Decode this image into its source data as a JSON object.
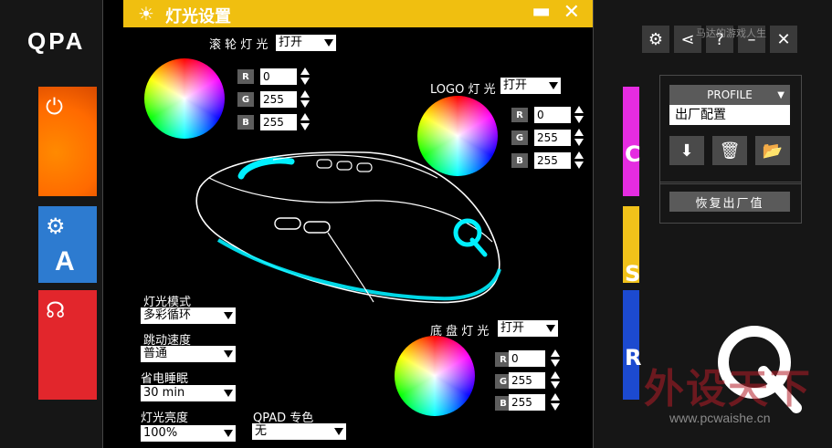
{
  "background_app": {
    "brand": "QPA",
    "watermark_top": "马达的游戏人生",
    "profile": {
      "header": "PROFILE",
      "name": "出厂配置"
    },
    "restore_label": "恢复出厂值",
    "stripes": [
      "C",
      "S",
      "R"
    ],
    "tile_letters": [
      "A"
    ],
    "site_mark": "外设天下",
    "site_url": "www.pcwaishe.cn"
  },
  "dialog": {
    "title": "灯光设置",
    "scroll": {
      "label": "滚 轮 灯 光",
      "mode": "打开",
      "rgb": {
        "R": "0",
        "G": "255",
        "B": "255"
      }
    },
    "logo": {
      "label": "LOGO 灯 光",
      "mode": "打开",
      "rgb": {
        "R": "0",
        "G": "255",
        "B": "255"
      }
    },
    "bottom": {
      "label": "底 盘 灯 光",
      "mode": "打开",
      "rgb": {
        "R": "0",
        "G": "255",
        "B": "255"
      }
    },
    "settings": {
      "light_mode_label": "灯光模式",
      "light_mode": "多彩循环",
      "speed_label": "跳动速度",
      "speed": "普通",
      "sleep_label": "省电睡眠",
      "sleep": "30 min",
      "brightness_label": "灯光亮度",
      "brightness": "100%",
      "qpad_color_label": "QPAD 专色",
      "qpad_color": "无"
    }
  },
  "colors": {
    "title_yellow": "#f0bf10",
    "glow": "#00f0ff"
  }
}
